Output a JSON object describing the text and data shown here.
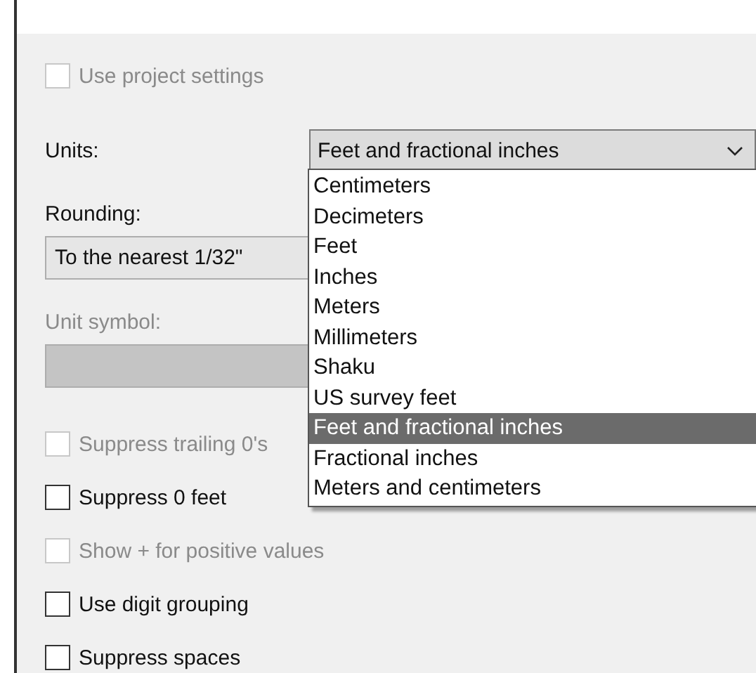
{
  "use_project_settings": {
    "label": "Use project settings",
    "checked": false,
    "disabled": true
  },
  "units": {
    "label": "Units:",
    "value": "Feet and fractional inches",
    "expanded": true,
    "options": [
      {
        "label": "Centimeters",
        "selected": false
      },
      {
        "label": "Decimeters",
        "selected": false
      },
      {
        "label": "Feet",
        "selected": false
      },
      {
        "label": "Inches",
        "selected": false
      },
      {
        "label": "Meters",
        "selected": false
      },
      {
        "label": "Millimeters",
        "selected": false
      },
      {
        "label": "Shaku",
        "selected": false
      },
      {
        "label": "US survey feet",
        "selected": false
      },
      {
        "label": "Feet and fractional inches",
        "selected": true
      },
      {
        "label": "Fractional inches",
        "selected": false
      },
      {
        "label": "Meters and centimeters",
        "selected": false
      }
    ]
  },
  "rounding": {
    "label": "Rounding:",
    "value": "To the nearest 1/32\""
  },
  "unit_symbol": {
    "label": "Unit symbol:",
    "disabled": true
  },
  "options": [
    {
      "label": "Suppress trailing 0's",
      "checked": false,
      "disabled": true
    },
    {
      "label": "Suppress 0 feet",
      "checked": false,
      "disabled": false
    },
    {
      "label": "Show + for positive values",
      "checked": false,
      "disabled": true
    },
    {
      "label": "Use digit grouping",
      "checked": false,
      "disabled": false
    },
    {
      "label": "Suppress spaces",
      "checked": false,
      "disabled": false
    }
  ]
}
